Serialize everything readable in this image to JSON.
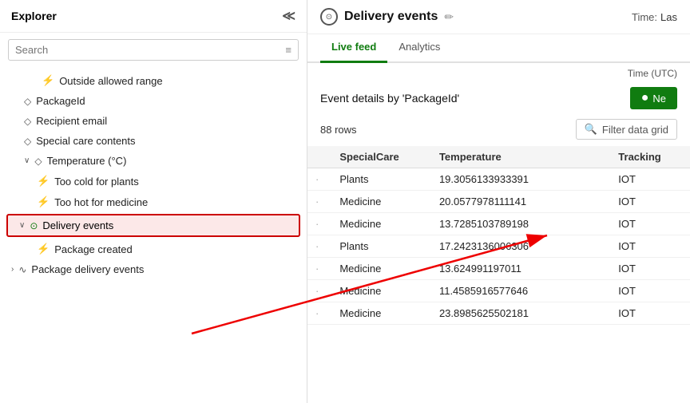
{
  "left": {
    "header": "Explorer",
    "search_placeholder": "Search",
    "tree": [
      {
        "id": "outside-allowed",
        "label": "Outside allowed range",
        "icon": "bolt",
        "indent": "indent2",
        "type": "rule"
      },
      {
        "id": "packageid",
        "label": "PackageId",
        "icon": "tag",
        "indent": "indent1",
        "type": "field"
      },
      {
        "id": "recipient-email",
        "label": "Recipient email",
        "icon": "email",
        "indent": "indent1",
        "type": "field"
      },
      {
        "id": "special-care",
        "label": "Special care contents",
        "icon": "shield",
        "indent": "indent1",
        "type": "field"
      },
      {
        "id": "temperature-group",
        "label": "Temperature (°C)",
        "icon": "thermo",
        "indent": "indent1",
        "type": "group",
        "expanded": true
      },
      {
        "id": "too-cold",
        "label": "Too cold for plants",
        "icon": "bolt",
        "indent": "indent2",
        "type": "rule"
      },
      {
        "id": "too-hot",
        "label": "Too hot for medicine",
        "icon": "bolt",
        "indent": "indent2",
        "type": "rule"
      },
      {
        "id": "delivery-events",
        "label": "Delivery events",
        "icon": "circle",
        "indent": "indent1",
        "type": "group",
        "highlighted": true,
        "expanded": true
      },
      {
        "id": "package-created",
        "label": "Package created",
        "icon": "bolt",
        "indent": "indent2",
        "type": "rule"
      },
      {
        "id": "package-delivery",
        "label": "Package delivery events",
        "icon": "wavy",
        "indent": "indent0",
        "type": "group"
      }
    ]
  },
  "right": {
    "title": "Delivery events",
    "time_label": "Time:",
    "time_value": "Las",
    "tabs": [
      {
        "id": "live-feed",
        "label": "Live feed",
        "active": true
      },
      {
        "id": "analytics",
        "label": "Analytics",
        "active": false
      }
    ],
    "time_utc": "Time (UTC)",
    "event_details_title": "Event details by 'PackageId'",
    "new_button_label": "Ne",
    "rows_count": "88 rows",
    "filter_placeholder": "Filter data grid",
    "table": {
      "columns": [
        "",
        "SpecialCare",
        "Temperature",
        "Tracking"
      ],
      "rows": [
        {
          "dot": "·",
          "specialcare": "Plants",
          "temperature": "19.3056133933391",
          "tracking": "IOT"
        },
        {
          "dot": "·",
          "specialcare": "Medicine",
          "temperature": "20.0577978111141",
          "tracking": "IOT"
        },
        {
          "dot": "·",
          "specialcare": "Medicine",
          "temperature": "13.7285103789198",
          "tracking": "IOT"
        },
        {
          "dot": "·",
          "specialcare": "Plants",
          "temperature": "17.2423136006306",
          "tracking": "IOT"
        },
        {
          "dot": "·",
          "specialcare": "Medicine",
          "temperature": "13.624991197011",
          "tracking": "IOT"
        },
        {
          "dot": "·",
          "specialcare": "Medicine",
          "temperature": "11.4585916577646",
          "tracking": "IOT"
        },
        {
          "dot": "·",
          "specialcare": "Medicine",
          "temperature": "23.8985625502181",
          "tracking": "IOT"
        }
      ]
    }
  },
  "icons": {
    "bolt": "⚡",
    "tag": "🏷",
    "shield": "🛡",
    "thermo": "🌡",
    "circle": "⊙",
    "wavy": "∿",
    "search": "🔍",
    "filter": "≡",
    "edit": "✏",
    "collapse": "≪",
    "chevron_right": "›",
    "chevron_down": "⌄",
    "dot": "·"
  },
  "colors": {
    "active_tab": "#107c10",
    "highlight_bg": "#fce8e8",
    "highlight_border": "#cc0000",
    "new_button": "#107c10"
  }
}
